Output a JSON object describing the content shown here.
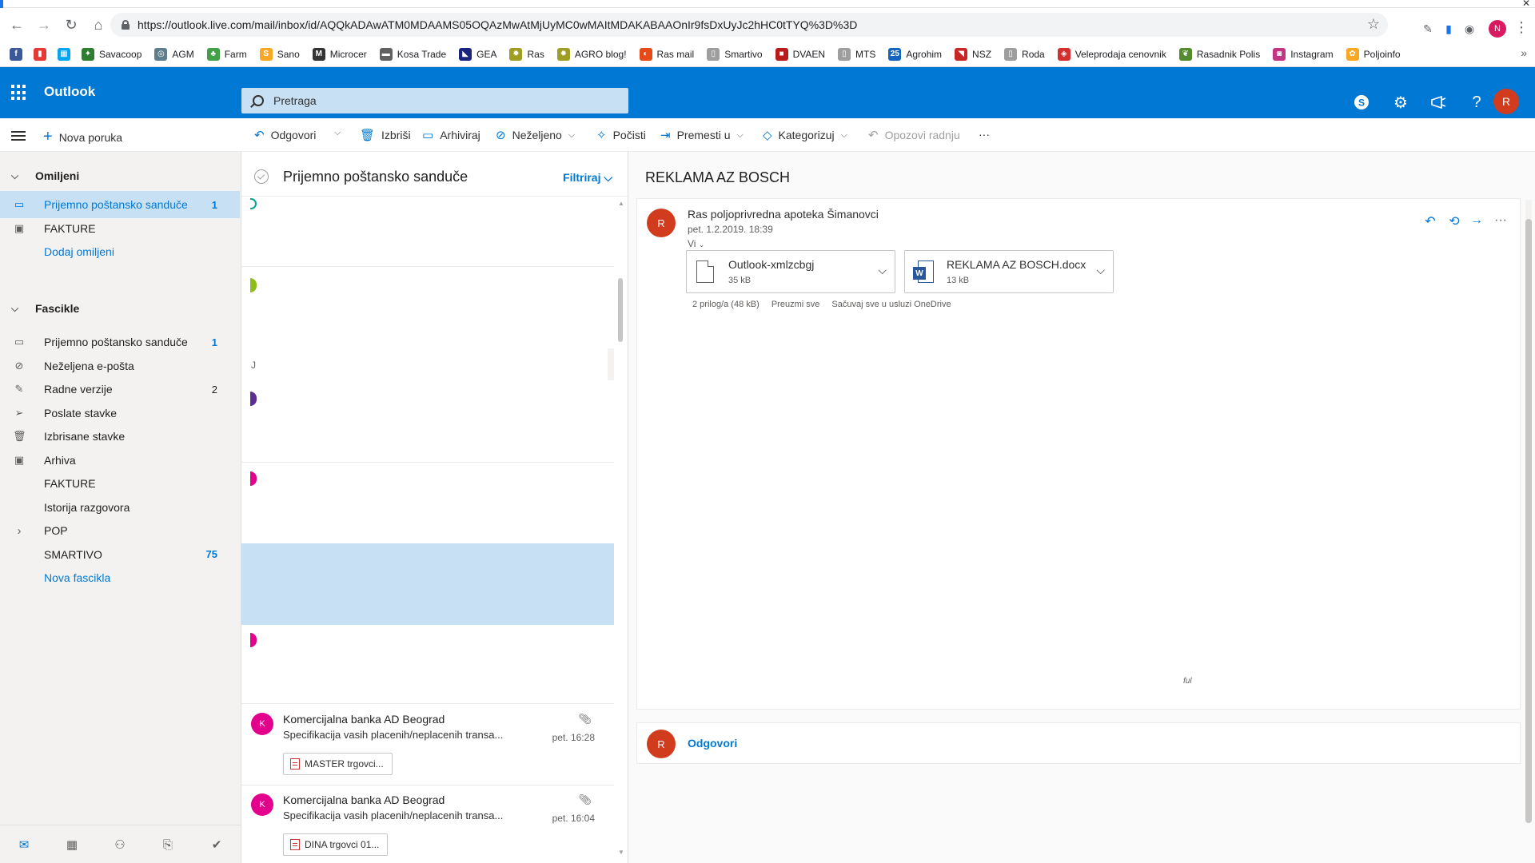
{
  "browser": {
    "url": "https://outlook.live.com/mail/inbox/id/AQQkADAwATM0MDAAMS05OQAzMwAtMjUyMC0wMAItMDAKABAAOnIr9fsDxUyJc2hHC0tTYQ%3D%3D",
    "profile_initial": "N",
    "bookmarks": [
      {
        "label": "",
        "icon": "facebook-icon",
        "color": "#3b5998"
      },
      {
        "label": "",
        "icon": "chart-icon",
        "color": "#e53935"
      },
      {
        "label": "",
        "icon": "windows-icon",
        "color": "#00a4ef"
      },
      {
        "label": "Savacoop",
        "icon": "leaf-icon",
        "color": "#2e7d32"
      },
      {
        "label": "AGM",
        "icon": "globe-icon",
        "color": "#607d8b"
      },
      {
        "label": "Farm",
        "icon": "tractor-icon",
        "color": "#43a047"
      },
      {
        "label": "Sano",
        "icon": "sano-icon",
        "color": "#f9a825"
      },
      {
        "label": "Microcer",
        "icon": "m-icon",
        "color": "#333333"
      },
      {
        "label": "Kosa Trade",
        "icon": "cart-icon",
        "color": "#616161"
      },
      {
        "label": "GEA",
        "icon": "gea-icon",
        "color": "#1a237e"
      },
      {
        "label": "Ras",
        "icon": "sun-icon",
        "color": "#9e9d24"
      },
      {
        "label": "AGRO blog!",
        "icon": "sun-icon",
        "color": "#9e9d24"
      },
      {
        "label": "Ras mail",
        "icon": "mail-icon",
        "color": "#e64a19"
      },
      {
        "label": "Smartivo",
        "icon": "page-icon",
        "color": "#9e9e9e"
      },
      {
        "label": "DVAEN",
        "icon": "dvaen-icon",
        "color": "#b71c1c"
      },
      {
        "label": "MTS",
        "icon": "page-icon",
        "color": "#9e9e9e"
      },
      {
        "label": "Agrohim",
        "icon": "calendar-icon",
        "color": "#1565c0"
      },
      {
        "label": "NSZ",
        "icon": "nsz-icon",
        "color": "#c62828"
      },
      {
        "label": "Roda",
        "icon": "page-icon",
        "color": "#9e9e9e"
      },
      {
        "label": "Veleprodaja cenovnik",
        "icon": "price-icon",
        "color": "#d32f2f"
      },
      {
        "label": "Rasadnik Polis",
        "icon": "plant-icon",
        "color": "#558b2f"
      },
      {
        "label": "Instagram",
        "icon": "instagram-icon",
        "color": "#c13584"
      },
      {
        "label": "Poljoinfo",
        "icon": "flower-icon",
        "color": "#f9a825"
      }
    ]
  },
  "header": {
    "app_name": "Outlook",
    "search_placeholder": "Pretraga",
    "user_initial": "R"
  },
  "commands": {
    "new_message": "Nova poruka",
    "reply": "Odgovori",
    "delete": "Izbriši",
    "archive": "Arhiviraj",
    "junk": "Neželjeno",
    "sweep": "Počisti",
    "move_to": "Premesti u",
    "categorize": "Kategorizuj",
    "undo": "Opozovi radnju",
    "more": "···"
  },
  "nav": {
    "favorites_label": "Omiljeni",
    "folders_label": "Fascikle",
    "favorites": [
      {
        "label": "Prijemno poštansko sanduče",
        "count": "1",
        "icon": "inbox-icon",
        "selected": true
      },
      {
        "label": "FAKTURE",
        "count": "",
        "icon": "archive-icon"
      },
      {
        "label": "Dodaj omiljeni",
        "count": "",
        "icon": "",
        "link": true
      }
    ],
    "folders": [
      {
        "label": "Prijemno poštansko sanduče",
        "count": "1",
        "icon": "inbox-icon"
      },
      {
        "label": "Neželjena e-pošta",
        "count": "",
        "icon": "block-icon"
      },
      {
        "label": "Radne verzije",
        "count": "2",
        "icon": "pencil-icon"
      },
      {
        "label": "Poslate stavke",
        "count": "",
        "icon": "send-icon"
      },
      {
        "label": "Izbrisane stavke",
        "count": "",
        "icon": "trash-icon"
      },
      {
        "label": "Arhiva",
        "count": "",
        "icon": "archive-icon"
      },
      {
        "label": "FAKTURE",
        "count": "",
        "icon": ""
      },
      {
        "label": "Istorija razgovora",
        "count": "",
        "icon": ""
      },
      {
        "label": "POP",
        "count": "",
        "icon": "chevron-right-icon"
      },
      {
        "label": "SMARTIVO",
        "count": "75",
        "icon": ""
      },
      {
        "label": "Nova fascikla",
        "count": "",
        "icon": "",
        "link": true
      }
    ]
  },
  "list": {
    "title": "Prijemno poštansko sanduče",
    "filter": "Filtriraj",
    "group_letter": "J",
    "messages": [
      {
        "initial": "K",
        "sender": "Komercijalna banka AD Beograd",
        "subject": "Specifikacija vasih placenih/neplacenih transa...",
        "time": "pet. 16:28",
        "attachment": "MASTER trgovci..."
      },
      {
        "initial": "K",
        "sender": "Komercijalna banka AD Beograd",
        "subject": "Specifikacija vasih placenih/neplacenih transa...",
        "time": "pet. 16:04",
        "attachment": "DINA trgovci 01..."
      }
    ]
  },
  "reading": {
    "subject": "REKLAMA AZ BOSCH",
    "from_initial": "R",
    "from": "Ras poljoprivredna apoteka Šimanovci",
    "date": "pet. 1.2.2019. 18:39",
    "to": "Vi",
    "attachments": [
      {
        "name": "Outlook-xmlzcbgj",
        "size": "35 kB",
        "type": "doc"
      },
      {
        "name": "REKLAMA AZ BOSCH.docx",
        "size": "13 kB",
        "type": "word"
      }
    ],
    "attachments_summary": "2 prilog/a (48 kB)",
    "download_all": "Preuzmi sve",
    "save_onedrive": "Sačuvaj sve u usluzi OneDrive",
    "body_mark": "ful",
    "reply_label": "Odgovori"
  },
  "colors": {
    "brand": "#0078d4",
    "selected_bg": "#c7e0f4",
    "avatar_r": "#d13c1e",
    "avatar_k": "#e3008c"
  }
}
